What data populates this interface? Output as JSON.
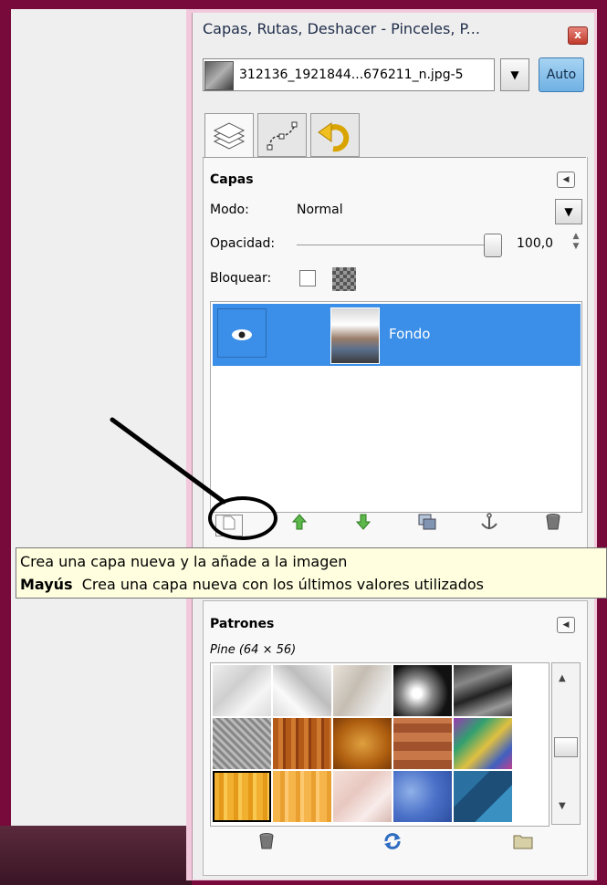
{
  "window": {
    "title": "Capas, Rutas, Deshacer - Pinceles, P...",
    "close_glyph": "x"
  },
  "image_selector": {
    "value": "312136_1921844...676211_n.jpg-5",
    "auto_label": "Auto"
  },
  "tabs": [
    {
      "name": "layers-tab",
      "icon": "layers-icon"
    },
    {
      "name": "paths-tab",
      "icon": "paths-icon"
    },
    {
      "name": "undo-tab",
      "icon": "undo-icon"
    }
  ],
  "layers_panel": {
    "title": "Capas",
    "mode_label": "Modo:",
    "mode_value": "Normal",
    "opacity_label": "Opacidad:",
    "opacity_value": "100,0",
    "opacity_fraction": 1.0,
    "lock_label": "Bloquear:",
    "layers": [
      {
        "name": "Fondo",
        "visible": true,
        "selected": true
      }
    ]
  },
  "tooltip": {
    "line1": "Crea una capa nueva y la añade a la imagen",
    "line2_key": "Mayús",
    "line2_text": "Crea una capa nueva con los últimos valores utilizados"
  },
  "patterns_panel": {
    "title": "Patrones",
    "info": "Pine (64 × 56)",
    "selected_index": 10
  },
  "colors": {
    "selection": "#3b8fe8",
    "tooltip_bg": "#ffffe0",
    "frame": "#770a3a",
    "dock_bg": "#eeeeee"
  }
}
